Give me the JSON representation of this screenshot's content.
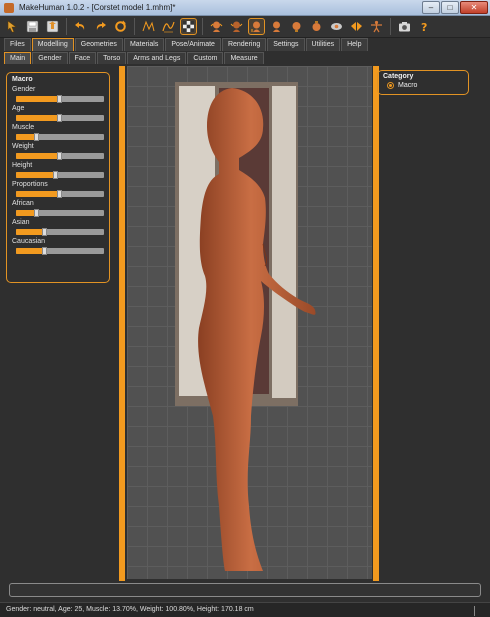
{
  "window": {
    "title": "MakeHuman 1.0.2 - [Corstet model 1.mhm]*",
    "minimize": "–",
    "maximize": "□",
    "close": "✕"
  },
  "toolbar": {
    "icons": [
      "pointer-icon",
      "save-icon",
      "export-icon",
      "undo-icon",
      "redo-icon",
      "reset-icon",
      "wireframe-icon",
      "smooth-icon",
      "checker-icon",
      "front-view-icon",
      "back-view-icon",
      "left-view-icon",
      "right-view-icon",
      "top-view-icon",
      "bottom-view-icon",
      "global-camera-icon",
      "symmetry-icon",
      "screenshot-icon",
      "help-icon"
    ]
  },
  "tabs": [
    {
      "label": "Files"
    },
    {
      "label": "Modelling",
      "active": true
    },
    {
      "label": "Geometries"
    },
    {
      "label": "Materials"
    },
    {
      "label": "Pose/Animate"
    },
    {
      "label": "Rendering"
    },
    {
      "label": "Settings"
    },
    {
      "label": "Utilities"
    },
    {
      "label": "Help"
    }
  ],
  "subtabs": [
    {
      "label": "Main",
      "active": true
    },
    {
      "label": "Gender"
    },
    {
      "label": "Face"
    },
    {
      "label": "Torso"
    },
    {
      "label": "Arms and Legs"
    },
    {
      "label": "Custom"
    },
    {
      "label": "Measure"
    }
  ],
  "macro": {
    "title": "Macro",
    "sliders": [
      {
        "label": "Gender",
        "value": 0.5
      },
      {
        "label": "Age",
        "value": 0.5
      },
      {
        "label": "Muscle",
        "value": 0.24
      },
      {
        "label": "Weight",
        "value": 0.5
      },
      {
        "label": "Height",
        "value": 0.46
      },
      {
        "label": "Proportions",
        "value": 0.5
      },
      {
        "label": "African",
        "value": 0.24
      },
      {
        "label": "Asian",
        "value": 0.33
      },
      {
        "label": "Caucasian",
        "value": 0.33
      }
    ]
  },
  "category": {
    "title": "Category",
    "options": [
      {
        "label": "Macro",
        "selected": true
      }
    ]
  },
  "status": {
    "text": "Gender: neutral, Age: 25, Muscle: 13.70%, Weight: 100.80%, Height: 170.18 cm"
  },
  "colors": {
    "accent": "#f29a1f",
    "skin": "#c2683f",
    "background": "#2f2f2f"
  }
}
